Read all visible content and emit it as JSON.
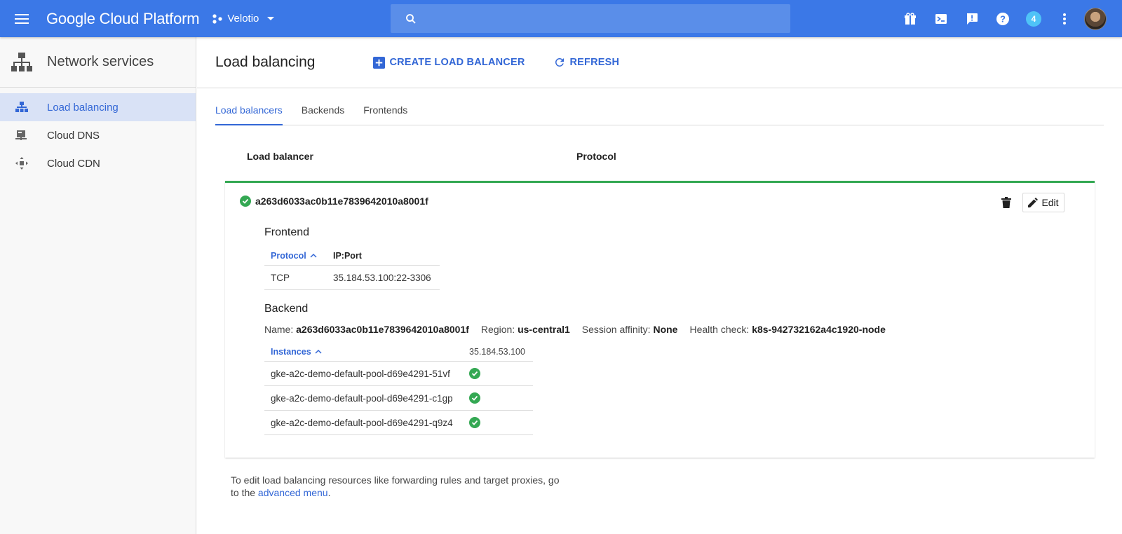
{
  "topbar": {
    "product_name": "Google Cloud Platform",
    "project_name": "Velotio",
    "notification_count": "4",
    "brand_color": "#3b78e7"
  },
  "sidebar": {
    "title": "Network services",
    "items": [
      {
        "label": "Load balancing",
        "icon": "load-balancing-icon",
        "active": true
      },
      {
        "label": "Cloud DNS",
        "icon": "dns-icon",
        "active": false
      },
      {
        "label": "Cloud CDN",
        "icon": "cdn-icon",
        "active": false
      }
    ]
  },
  "main": {
    "page_title": "Load balancing",
    "create_label": "CREATE LOAD BALANCER",
    "refresh_label": "REFRESH",
    "tabs": [
      {
        "label": "Load balancers",
        "active": true
      },
      {
        "label": "Backends",
        "active": false
      },
      {
        "label": "Frontends",
        "active": false
      }
    ],
    "columns": {
      "load_balancer": "Load balancer",
      "protocol": "Protocol"
    },
    "load_balancer": {
      "name": "a263d6033ac0b11e7839642010a8001f",
      "status_color": "#34a853",
      "edit_label": "Edit",
      "frontend": {
        "title": "Frontend",
        "protocol_header": "Protocol",
        "ipport_header": "IP:Port",
        "rows": [
          {
            "protocol": "TCP",
            "ipport": "35.184.53.100:22-3306"
          }
        ]
      },
      "backend": {
        "title": "Backend",
        "name_label": "Name:",
        "name_value": "a263d6033ac0b11e7839642010a8001f",
        "region_label": "Region:",
        "region_value": "us-central1",
        "affinity_label": "Session affinity:",
        "affinity_value": "None",
        "health_label": "Health check:",
        "health_value": "k8s-942732162a4c1920-node",
        "instances_header": "Instances",
        "ip_header": "35.184.53.100",
        "instances": [
          {
            "name": "gke-a2c-demo-default-pool-d69e4291-51vf",
            "healthy": true
          },
          {
            "name": "gke-a2c-demo-default-pool-d69e4291-c1gp",
            "healthy": true
          },
          {
            "name": "gke-a2c-demo-default-pool-d69e4291-q9z4",
            "healthy": true
          }
        ]
      }
    },
    "footer": {
      "text": "To edit load balancing resources like forwarding rules and target proxies, go to the",
      "link": "advanced menu",
      "end": "."
    }
  }
}
